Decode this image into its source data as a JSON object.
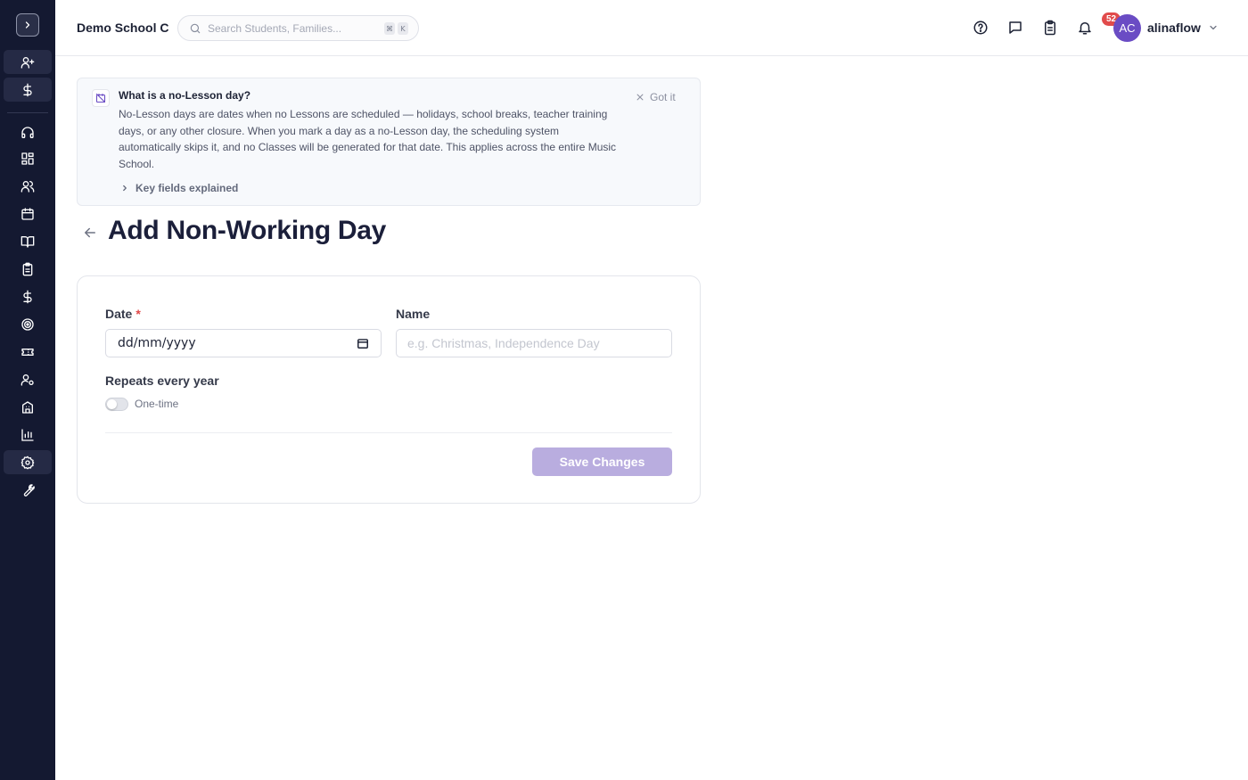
{
  "header": {
    "school_name": "Demo School C",
    "search_placeholder": "Search Students, Families...",
    "search_shortcut": [
      "⌘",
      "K"
    ],
    "tasks_badge": "52",
    "user": {
      "initials": "AC",
      "name": "alinaflow"
    }
  },
  "sidebar": {
    "items": [
      {
        "icon": "user-plus-icon"
      },
      {
        "icon": "dollar-icon"
      },
      {
        "icon": "headset-icon"
      },
      {
        "icon": "dashboard-icon"
      },
      {
        "icon": "users-icon"
      },
      {
        "icon": "calendar-icon"
      },
      {
        "icon": "book-icon"
      },
      {
        "icon": "clipboard-icon"
      },
      {
        "icon": "dollar-icon"
      },
      {
        "icon": "target-icon"
      },
      {
        "icon": "ticket-icon"
      },
      {
        "icon": "user-settings-icon"
      },
      {
        "icon": "building-icon"
      },
      {
        "icon": "bar-chart-icon"
      },
      {
        "icon": "gear-icon"
      },
      {
        "icon": "wrench-icon"
      }
    ]
  },
  "info_banner": {
    "title": "What is a no-Lesson day?",
    "body": "No-Lesson days are dates when no Lessons are scheduled — holidays, school breaks, teacher training days, or any other closure. When you mark a day as a no-Lesson day, the scheduling system automatically skips it, and no Classes will be generated for that date. This applies across the entire Music School.",
    "dismiss_label": "Got it",
    "key_fields_label": "Key fields explained"
  },
  "page": {
    "title": "Add Non-Working Day"
  },
  "form": {
    "date_label": "Date",
    "date_required_mark": "*",
    "date_value": "dd/mm/yyyy",
    "name_label": "Name",
    "name_placeholder": "e.g. Christmas, Independence Day",
    "repeat_label": "Repeats every year",
    "repeat_state": "One-time",
    "save_label": "Save Changes"
  },
  "colors": {
    "sidebar_bg": "#141931",
    "accent": "#6a4cc4",
    "save_disabled": "#b9addf",
    "badge": "#e14b4b"
  }
}
